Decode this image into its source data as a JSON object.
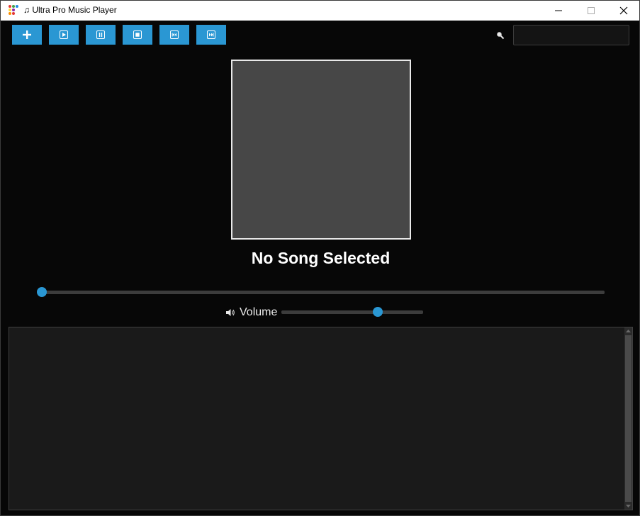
{
  "window": {
    "title": "Ultra Pro Music Player",
    "title_icon": "music-note-icon",
    "controls": [
      "minimize",
      "maximize",
      "close"
    ]
  },
  "toolbar": {
    "buttons": [
      {
        "name": "add",
        "icon": "plus-icon"
      },
      {
        "name": "play",
        "icon": "play-icon"
      },
      {
        "name": "pause",
        "icon": "pause-icon"
      },
      {
        "name": "stop",
        "icon": "stop-icon"
      },
      {
        "name": "previous",
        "icon": "previous-track-icon"
      },
      {
        "name": "next",
        "icon": "next-track-icon"
      }
    ],
    "accent_color": "#2a97d3"
  },
  "search": {
    "icon": "magnifier-icon",
    "value": "",
    "placeholder": ""
  },
  "now_playing": {
    "title": "No Song Selected",
    "progress": 0
  },
  "volume": {
    "label": "Volume",
    "icon": "speaker-icon",
    "level": 0.68
  },
  "playlist": {
    "items": []
  }
}
